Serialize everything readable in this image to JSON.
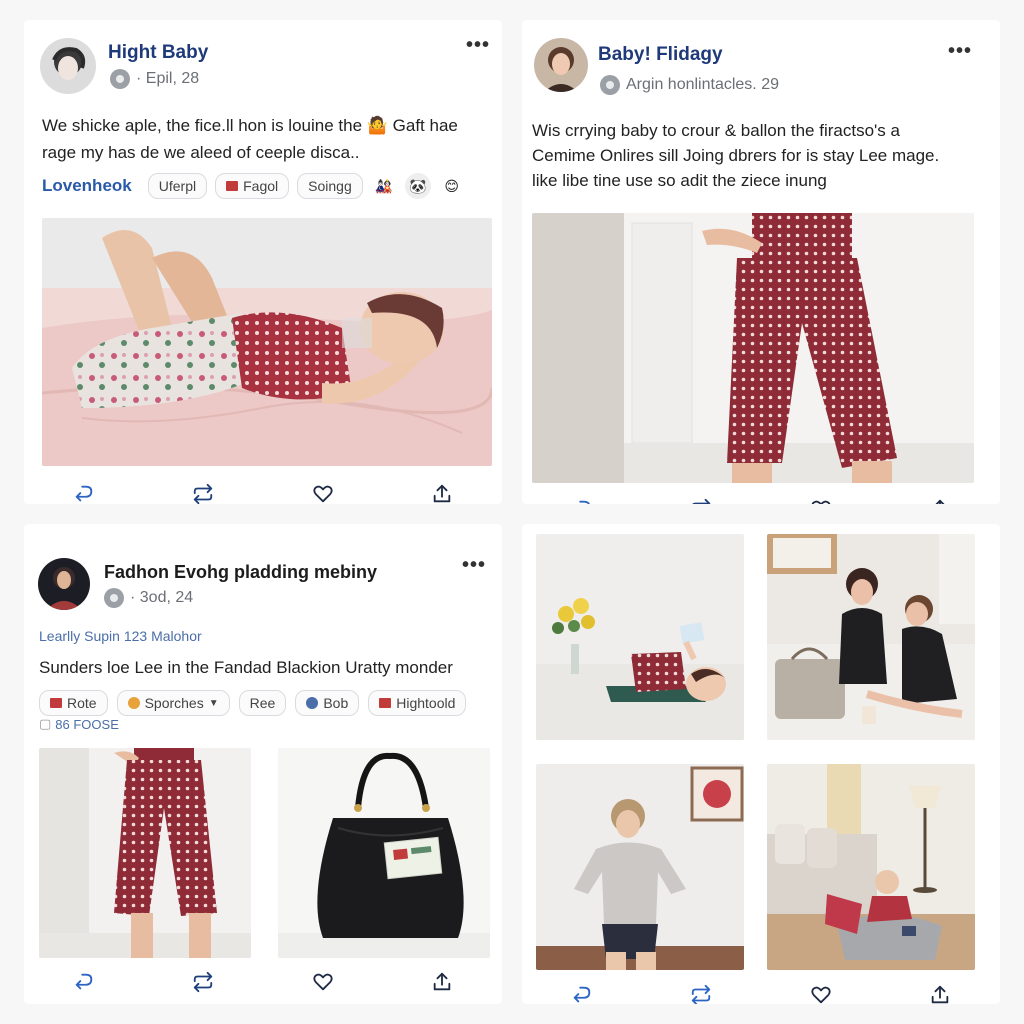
{
  "posts": [
    {
      "author": "Hight Baby",
      "meta": "· Epil, 28",
      "text_line1": "We shicke aple, the fice.ll hon is louine the 🤷 Gaft hae",
      "text_line2": "rage my has de we aleed of ceeple disca..",
      "tag_link": "Lovenheok",
      "chips": [
        "Uferpl",
        "Fagol",
        "Soingg"
      ],
      "emojis": [
        "🎎",
        "🐼",
        "😊"
      ],
      "icons": [
        "reply-icon",
        "repost-icon",
        "heart-icon",
        "share-icon"
      ]
    },
    {
      "author": "Baby! Flidagy",
      "meta": "Argin honlintacles. 29",
      "text_line1": "Wis crrying baby to crour & ballon the firactso's a",
      "text_line2": "Cemime Onlires sill Joing dbrers for is stay Lee mage.",
      "text_line3": "like libe tine use so adit the ziece inung",
      "icons": [
        "reply-icon",
        "repost-icon",
        "heart-icon",
        "share-icon"
      ]
    },
    {
      "author": "Fadhon Evohg pladding mebiny",
      "meta": "· 3od, 24",
      "subline": "Learlly Supin 123 Malohor",
      "text_line1": "Sunders loe Lee in the Fandad Blackion Uratty monder",
      "chips": [
        "Rote",
        "Sporches",
        "Ree",
        "Bob",
        "Hightoold"
      ],
      "count": "86 FOOSE",
      "icons": [
        "reply-icon",
        "repost-icon",
        "heart-icon",
        "share-icon"
      ]
    },
    {
      "icons": [
        "reply-icon",
        "repost-icon",
        "heart-icon",
        "share-icon"
      ]
    }
  ],
  "colors": {
    "author": "#1f3a7a",
    "link": "#2b5aa8",
    "polka_red": "#a8323f",
    "background": "#f7f7f8"
  }
}
